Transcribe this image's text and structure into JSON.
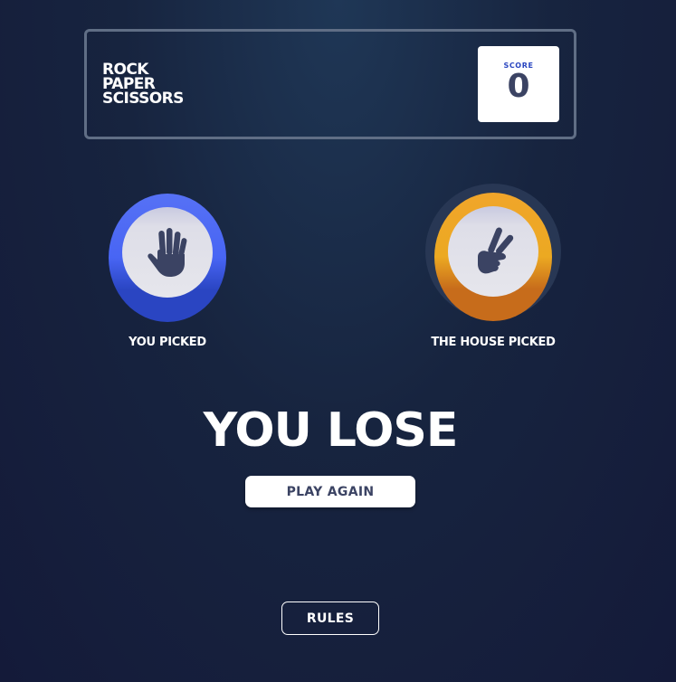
{
  "header": {
    "title_lines": [
      "ROCK",
      "PAPER",
      "SCISSORS"
    ],
    "score_label": "SCORE",
    "score_value": "0"
  },
  "player": {
    "label": "YOU PICKED",
    "choice": "paper",
    "icon": "hand-paper-icon",
    "ring_color": "#4865f4"
  },
  "house": {
    "label": "THE HOUSE PICKED",
    "choice": "scissors",
    "icon": "hand-scissors-icon",
    "ring_color": "#eca922"
  },
  "result": {
    "text": "YOU LOSE",
    "play_again_label": "PLAY AGAIN"
  },
  "footer": {
    "rules_label": "RULES"
  }
}
